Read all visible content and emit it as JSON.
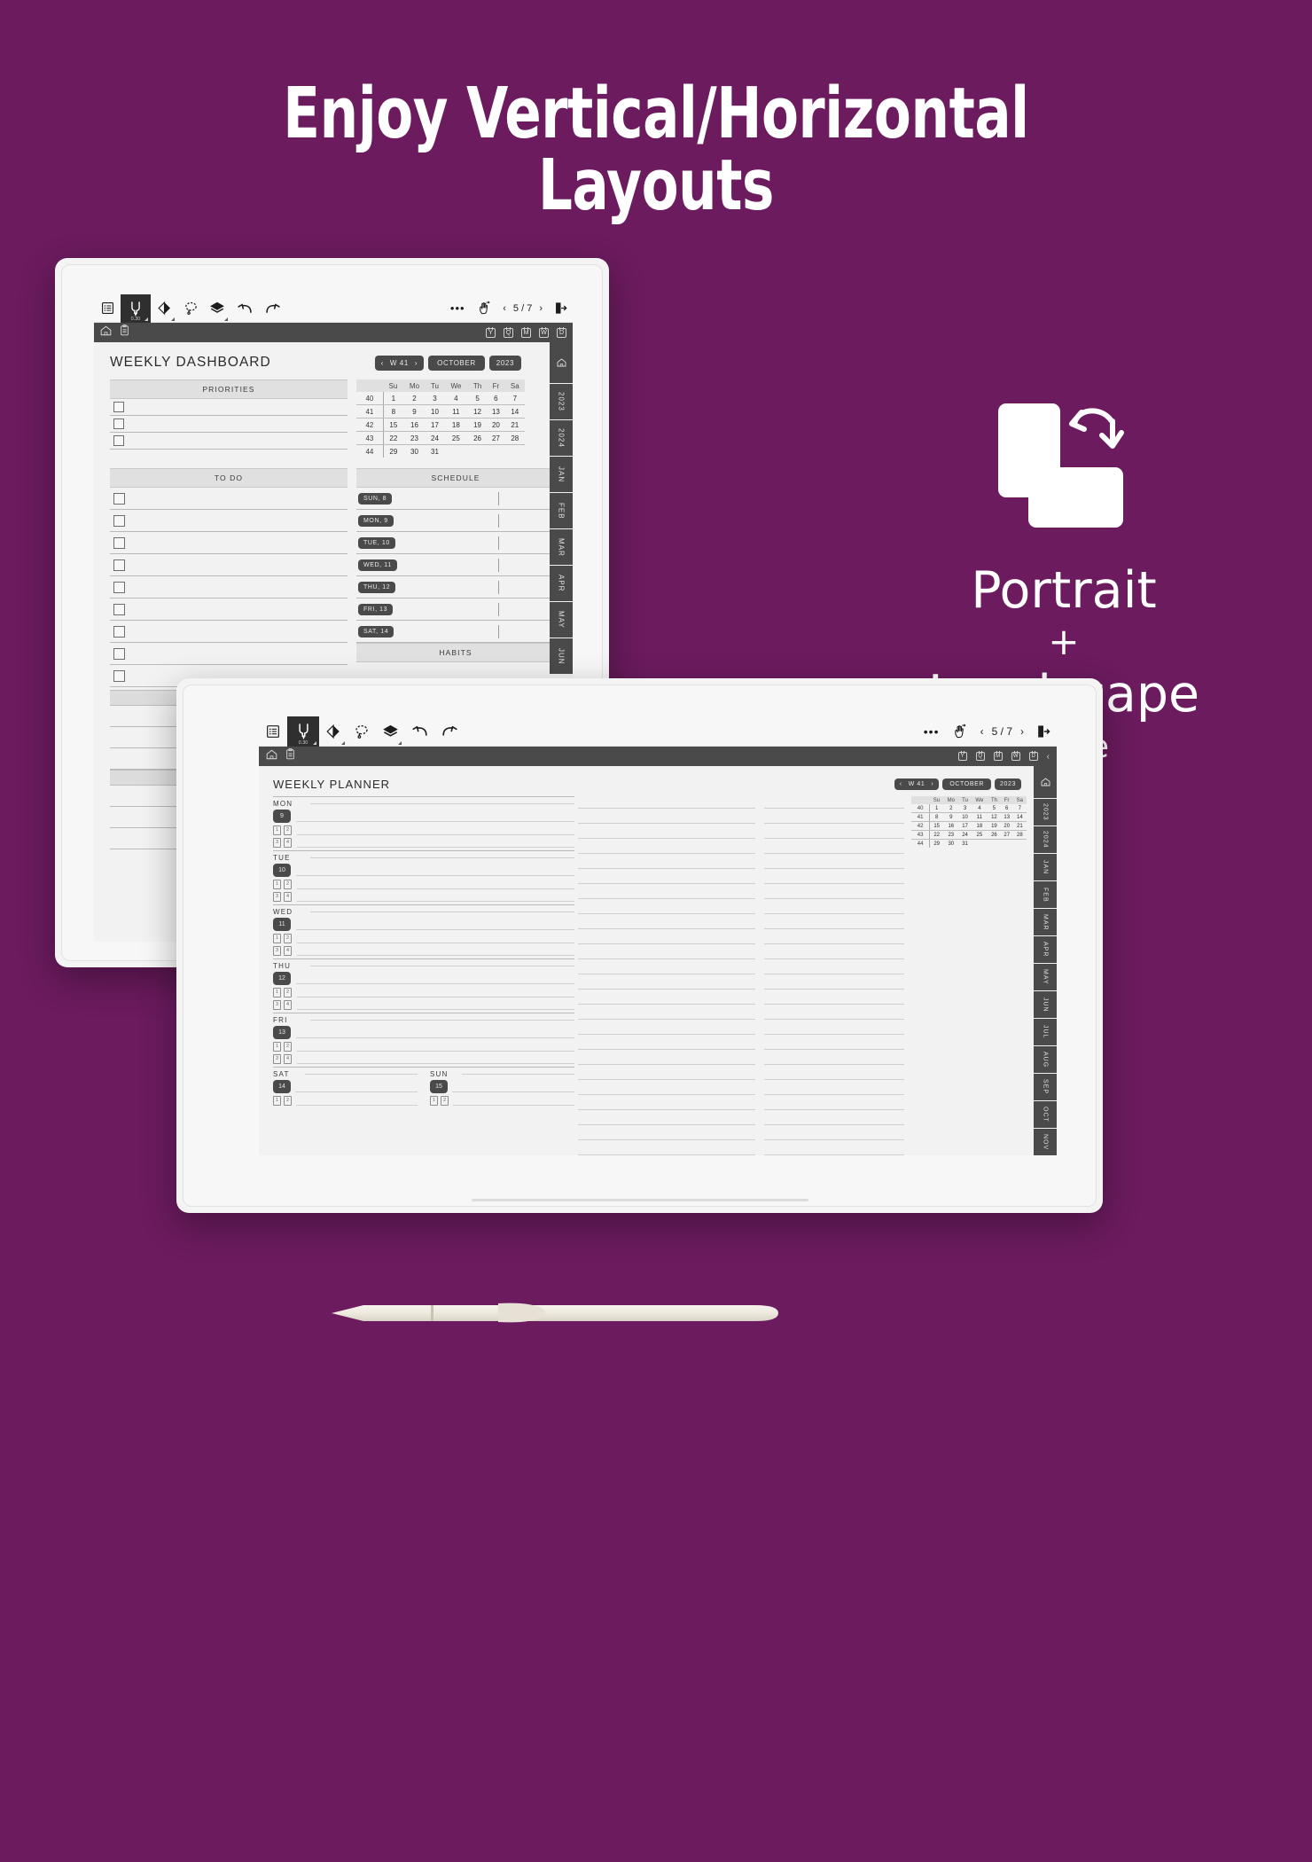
{
  "theme": {
    "background": "#6B1B5E",
    "text_on_background": "#FFFFFF",
    "device_body": "#F4F4F4",
    "screen_bg": "#F2F2F2",
    "dark_ui": "#4A4A4A",
    "toolbar_bg": "#F7F7F7"
  },
  "headline": {
    "line1": "Enjoy Vertical/Horizontal",
    "line2": "Layouts"
  },
  "info_panel": {
    "icon": "rotate-orientation-icon",
    "title": "Portrait",
    "plus": "+",
    "subtitle": "Landscape",
    "caption": "mode"
  },
  "toolbar": {
    "tools": [
      {
        "name": "menu-list-icon",
        "label": "Menu",
        "active": false
      },
      {
        "name": "pen-icon",
        "label": "Pen",
        "active": true,
        "size": "0.30",
        "has_caret": true
      },
      {
        "name": "eraser-icon",
        "label": "Eraser",
        "active": false,
        "has_caret": true
      },
      {
        "name": "lasso-select-icon",
        "label": "Lasso",
        "active": false
      },
      {
        "name": "layers-icon",
        "label": "Layers",
        "active": false,
        "has_caret": true,
        "has_eye": true
      },
      {
        "name": "undo-icon",
        "label": "Undo",
        "active": false
      },
      {
        "name": "redo-icon",
        "label": "Redo",
        "active": false
      }
    ],
    "more_label": "•••",
    "hand_tool": "hand-pan-icon",
    "prev_label": "‹",
    "page_indicator": "5 / 7",
    "next_label": "›",
    "export_icon": "export-page-icon"
  },
  "darkbar": {
    "home_icon": "home-icon",
    "clipboard_icon": "clipboard-icon",
    "jump_tabs": [
      "Y",
      "Q",
      "M",
      "W",
      "D"
    ],
    "collapse_label": "‹"
  },
  "sidebar": {
    "home_icon": "home-icon",
    "items": [
      "2023",
      "2024",
      "JAN",
      "FEB",
      "MAR",
      "APR",
      "MAY",
      "JUN",
      "JUL",
      "AUG",
      "SEP",
      "OCT",
      "NOV"
    ],
    "portrait_visible_count": 8
  },
  "portrait_page": {
    "title": "WEEKLY DASHBOARD",
    "week_badge": "W 41",
    "month_badge": "OCTOBER",
    "year_badge": "2023",
    "priorities_header": "PRIORITIES",
    "priorities_rows": 3,
    "todo_header": "TO DO",
    "todo_rows": 9,
    "schedule_header": "SCHEDULE",
    "schedule_days": [
      "SUN, 8",
      "MON, 9",
      "TUE, 10",
      "WED, 11",
      "THU, 12",
      "FRI, 13",
      "SAT, 14"
    ],
    "habits_header": "HABITS",
    "calendar": {
      "weekday_headers": [
        "Su",
        "Mo",
        "Tu",
        "We",
        "Th",
        "Fr",
        "Sa"
      ],
      "weeks": [
        {
          "wk": "40",
          "days": [
            "1",
            "2",
            "3",
            "4",
            "5",
            "6",
            "7"
          ]
        },
        {
          "wk": "41",
          "days": [
            "8",
            "9",
            "10",
            "11",
            "12",
            "13",
            "14"
          ]
        },
        {
          "wk": "42",
          "days": [
            "15",
            "16",
            "17",
            "18",
            "19",
            "20",
            "21"
          ]
        },
        {
          "wk": "43",
          "days": [
            "22",
            "23",
            "24",
            "25",
            "26",
            "27",
            "28"
          ]
        },
        {
          "wk": "44",
          "days": [
            "29",
            "30",
            "31",
            "",
            "",
            "",
            ""
          ]
        }
      ]
    }
  },
  "landscape_page": {
    "title": "WEEKLY PLANNER",
    "week_badge": "W 41",
    "month_badge": "OCTOBER",
    "year_badge": "2023",
    "page_icons": [
      "1",
      "2",
      "3",
      "4"
    ],
    "days": [
      {
        "name": "MON",
        "date": "9"
      },
      {
        "name": "TUE",
        "date": "10"
      },
      {
        "name": "WED",
        "date": "11"
      },
      {
        "name": "THU",
        "date": "12"
      },
      {
        "name": "FRI",
        "date": "13"
      },
      {
        "name": "SAT",
        "date": "14"
      },
      {
        "name": "SUN",
        "date": "15"
      }
    ],
    "calendar": {
      "weekday_headers": [
        "Su",
        "Mo",
        "Tu",
        "We",
        "Th",
        "Fr",
        "Sa"
      ],
      "weeks": [
        {
          "wk": "40",
          "days": [
            "1",
            "2",
            "3",
            "4",
            "5",
            "6",
            "7"
          ]
        },
        {
          "wk": "41",
          "days": [
            "8",
            "9",
            "10",
            "11",
            "12",
            "13",
            "14"
          ]
        },
        {
          "wk": "42",
          "days": [
            "15",
            "16",
            "17",
            "18",
            "19",
            "20",
            "21"
          ]
        },
        {
          "wk": "43",
          "days": [
            "22",
            "23",
            "24",
            "25",
            "26",
            "27",
            "28"
          ]
        },
        {
          "wk": "44",
          "days": [
            "29",
            "30",
            "31",
            "",
            "",
            "",
            ""
          ]
        }
      ]
    }
  }
}
